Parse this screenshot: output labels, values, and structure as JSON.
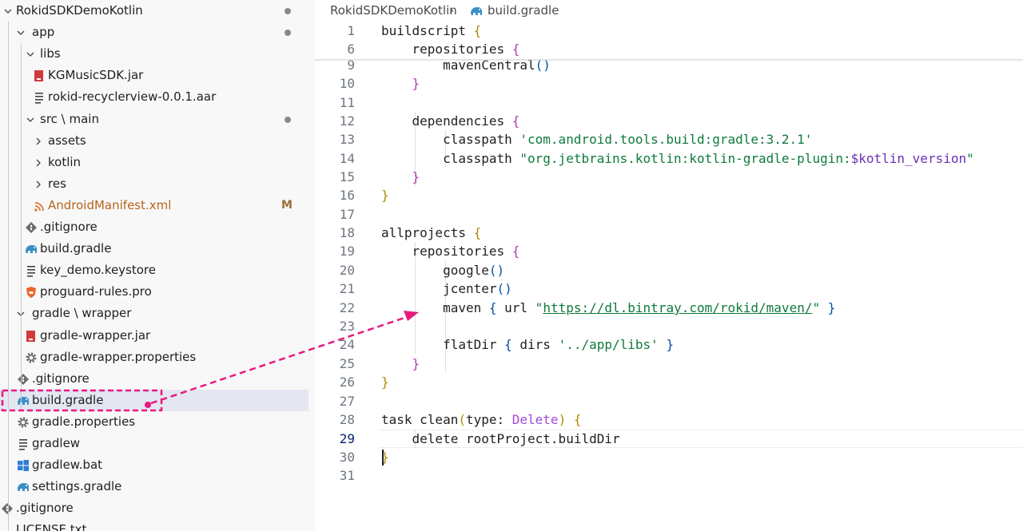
{
  "explorer": {
    "items": [
      {
        "label": "RokidSDKDemoKotlin",
        "indent": 0,
        "chevron": "down",
        "icon": "",
        "badge": "dot"
      },
      {
        "label": "app",
        "indent": 1,
        "chevron": "down",
        "icon": "",
        "badge": "dot"
      },
      {
        "label": "libs",
        "indent": 2,
        "chevron": "down",
        "icon": "",
        "badge": ""
      },
      {
        "label": "KGMusicSDK.jar",
        "indent": 3,
        "chevron": "",
        "icon": "jar-file-icon",
        "badge": ""
      },
      {
        "label": "rokid-recyclerview-0.0.1.aar",
        "indent": 3,
        "chevron": "",
        "icon": "text-file-icon",
        "badge": ""
      },
      {
        "label": "src \\ main",
        "indent": 2,
        "chevron": "down",
        "icon": "",
        "badge": "dot"
      },
      {
        "label": "assets",
        "indent": 3,
        "chevron": "right",
        "icon": "",
        "badge": ""
      },
      {
        "label": "kotlin",
        "indent": 3,
        "chevron": "right",
        "icon": "",
        "badge": ""
      },
      {
        "label": "res",
        "indent": 3,
        "chevron": "right",
        "icon": "",
        "badge": ""
      },
      {
        "label": "AndroidManifest.xml",
        "indent": 3,
        "chevron": "",
        "icon": "rss-icon",
        "badge": "M",
        "color": "#b5651d"
      },
      {
        "label": ".gitignore",
        "indent": 2,
        "chevron": "",
        "icon": "git-icon",
        "badge": ""
      },
      {
        "label": "build.gradle",
        "indent": 2,
        "chevron": "",
        "icon": "gradle-elephant-icon",
        "badge": ""
      },
      {
        "label": "key_demo.keystore",
        "indent": 2,
        "chevron": "",
        "icon": "text-file-icon",
        "badge": ""
      },
      {
        "label": "proguard-rules.pro",
        "indent": 2,
        "chevron": "",
        "icon": "proguard-shield-icon",
        "badge": ""
      },
      {
        "label": "gradle \\ wrapper",
        "indent": 1,
        "chevron": "down",
        "icon": "",
        "badge": ""
      },
      {
        "label": "gradle-wrapper.jar",
        "indent": 2,
        "chevron": "",
        "icon": "jar-file-icon",
        "badge": ""
      },
      {
        "label": "gradle-wrapper.properties",
        "indent": 2,
        "chevron": "",
        "icon": "gear-icon",
        "badge": ""
      },
      {
        "label": ".gitignore",
        "indent": 1,
        "chevron": "",
        "icon": "git-icon",
        "badge": ""
      },
      {
        "label": "build.gradle",
        "indent": 1,
        "chevron": "",
        "icon": "gradle-elephant-icon",
        "badge": "",
        "selected": true
      },
      {
        "label": "gradle.properties",
        "indent": 1,
        "chevron": "",
        "icon": "gear-icon",
        "badge": ""
      },
      {
        "label": "gradlew",
        "indent": 1,
        "chevron": "",
        "icon": "text-file-icon",
        "badge": ""
      },
      {
        "label": "gradlew.bat",
        "indent": 1,
        "chevron": "",
        "icon": "windows-icon",
        "badge": ""
      },
      {
        "label": "settings.gradle",
        "indent": 1,
        "chevron": "",
        "icon": "gradle-elephant-icon",
        "badge": ""
      },
      {
        "label": ".gitignore",
        "indent": 0,
        "chevron": "",
        "icon": "git-icon",
        "badge": ""
      },
      {
        "label": "LICENSE.txt",
        "indent": 0,
        "chevron": "",
        "icon": "",
        "badge": ""
      }
    ]
  },
  "breadcrumb": {
    "project": "RokidSDKDemoKotlin",
    "separator": "›",
    "file": "build.gradle"
  },
  "editor": {
    "active_line": "29",
    "lines": [
      {
        "num": "1",
        "sticky": true,
        "tokens": [
          [
            "buildscript ",
            ""
          ],
          [
            "{",
            "br1"
          ]
        ]
      },
      {
        "num": "6",
        "sticky": true,
        "tokens": [
          [
            "    repositories ",
            ""
          ],
          [
            "{",
            "br2"
          ]
        ]
      },
      {
        "num": "9",
        "tokens": [
          [
            "        mavenCentral",
            ""
          ],
          [
            "()",
            "br3"
          ]
        ]
      },
      {
        "num": "10",
        "tokens": [
          [
            "    ",
            ""
          ],
          [
            "}",
            "br2"
          ]
        ]
      },
      {
        "num": "11",
        "tokens": []
      },
      {
        "num": "12",
        "tokens": [
          [
            "    dependencies ",
            ""
          ],
          [
            "{",
            "br2"
          ]
        ]
      },
      {
        "num": "13",
        "tokens": [
          [
            "        classpath ",
            ""
          ],
          [
            "'com.android.tools.build:gradle:3.2.1'",
            "str"
          ]
        ]
      },
      {
        "num": "14",
        "tokens": [
          [
            "        classpath ",
            ""
          ],
          [
            "\"org.jetbrains.kotlin:kotlin-gradle-plugin:",
            "str"
          ],
          [
            "$kotlin_version",
            "var"
          ],
          [
            "\"",
            "str"
          ]
        ]
      },
      {
        "num": "15",
        "tokens": [
          [
            "    ",
            ""
          ],
          [
            "}",
            "br2"
          ]
        ]
      },
      {
        "num": "16",
        "tokens": [
          [
            "}",
            "br1"
          ]
        ]
      },
      {
        "num": "17",
        "tokens": []
      },
      {
        "num": "18",
        "tokens": [
          [
            "allprojects ",
            ""
          ],
          [
            "{",
            "br1"
          ]
        ]
      },
      {
        "num": "19",
        "tokens": [
          [
            "    repositories ",
            ""
          ],
          [
            "{",
            "br2"
          ]
        ]
      },
      {
        "num": "20",
        "tokens": [
          [
            "        google",
            ""
          ],
          [
            "()",
            "br3"
          ]
        ]
      },
      {
        "num": "21",
        "tokens": [
          [
            "        jcenter",
            ""
          ],
          [
            "()",
            "br3"
          ]
        ]
      },
      {
        "num": "22",
        "tokens": [
          [
            "        maven ",
            ""
          ],
          [
            "{",
            "br3"
          ],
          [
            " url ",
            ""
          ],
          [
            "\"",
            "str"
          ],
          [
            "https://dl.bintray.com/rokid/maven/",
            "url"
          ],
          [
            "\"",
            "str"
          ],
          [
            " ",
            ""
          ],
          [
            "}",
            "br3"
          ]
        ]
      },
      {
        "num": "23",
        "tokens": []
      },
      {
        "num": "24",
        "tokens": [
          [
            "        flatDir ",
            ""
          ],
          [
            "{",
            "br3"
          ],
          [
            " dirs ",
            ""
          ],
          [
            "'../app/libs'",
            "str"
          ],
          [
            " ",
            ""
          ],
          [
            "}",
            "br3"
          ]
        ]
      },
      {
        "num": "25",
        "tokens": [
          [
            "    ",
            ""
          ],
          [
            "}",
            "br2"
          ]
        ]
      },
      {
        "num": "26",
        "tokens": [
          [
            "}",
            "br1"
          ]
        ]
      },
      {
        "num": "27",
        "tokens": []
      },
      {
        "num": "28",
        "tokens": [
          [
            "task clean",
            ""
          ],
          [
            "(",
            "br1"
          ],
          [
            "type: ",
            ""
          ],
          [
            "Delete",
            "type"
          ],
          [
            ") ",
            "br1"
          ],
          [
            "{",
            "br1"
          ]
        ]
      },
      {
        "num": "29",
        "tokens": [
          [
            "    delete rootProject.buildDir",
            ""
          ]
        ]
      },
      {
        "num": "30",
        "tokens": [
          [
            "}",
            "br1"
          ]
        ]
      },
      {
        "num": "31",
        "tokens": []
      }
    ]
  },
  "colors": {
    "annotation": "#e8197e",
    "selected_row": "#e4e6f1",
    "gradle_icon": "#3a8fc7",
    "jar_icon": "#d0393e"
  }
}
